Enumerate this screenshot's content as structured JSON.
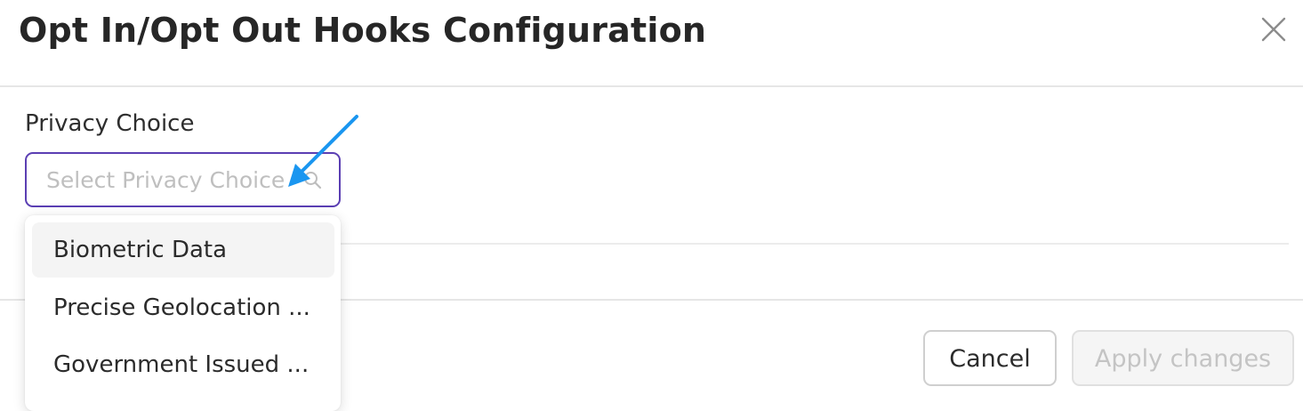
{
  "modal": {
    "title": "Opt In/Opt Out Hooks Configuration",
    "close_icon": "close-x-icon"
  },
  "form": {
    "privacy_choice": {
      "label": "Privacy Choice",
      "placeholder": "Select Privacy Choice",
      "value": "",
      "icon": "search-icon",
      "options": [
        "Biometric Data",
        "Precise Geolocation ...",
        "Government Issued ..."
      ],
      "highlighted_option": "Biometric Data"
    }
  },
  "footer": {
    "cancel_label": "Cancel",
    "apply_label": "Apply changes"
  },
  "colors": {
    "focus_border": "#5b3fb3",
    "annotation_arrow": "#1a96f0",
    "disabled_text": "#c4c4c4"
  }
}
